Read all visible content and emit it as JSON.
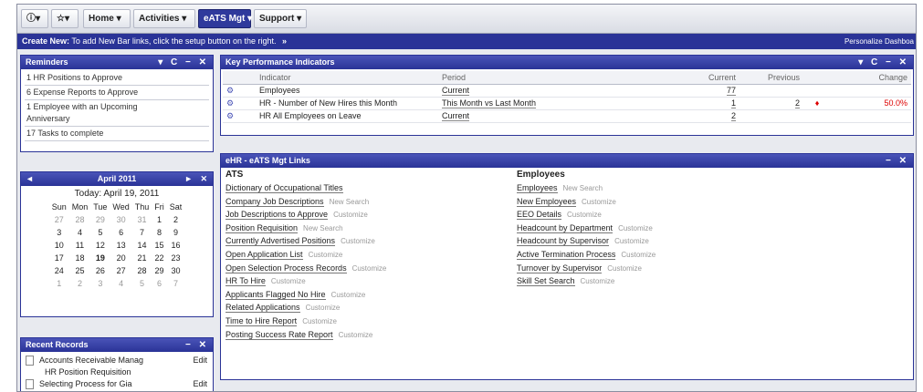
{
  "nav": {
    "home": "Home",
    "activities": "Activities",
    "eats": "eATS Mgt",
    "support": "Support",
    "dd": "▾"
  },
  "create": {
    "label": "Create New:",
    "text": "To add New Bar links, click the setup button on the right.",
    "arrow": "»",
    "personalize": "Personalize Dashboa"
  },
  "reminders": {
    "title": "Reminders",
    "controls": "▾ C − ✕",
    "items": [
      "1 HR Positions to Approve",
      "6 Expense Reports to Approve",
      "1 Employee with an Upcoming Anniversary",
      "17 Tasks to complete"
    ]
  },
  "calendar": {
    "title": "April 2011",
    "today": "Today: April 19, 2011",
    "days": [
      "Sun",
      "Mon",
      "Tue",
      "Wed",
      "Thu",
      "Fri",
      "Sat"
    ],
    "weeks": [
      [
        "27",
        "28",
        "29",
        "30",
        "31",
        "1",
        "2"
      ],
      [
        "3",
        "4",
        "5",
        "6",
        "7",
        "8",
        "9"
      ],
      [
        "10",
        "11",
        "12",
        "13",
        "14",
        "15",
        "16"
      ],
      [
        "17",
        "18",
        "19",
        "20",
        "21",
        "22",
        "23"
      ],
      [
        "24",
        "25",
        "26",
        "27",
        "28",
        "29",
        "30"
      ],
      [
        "1",
        "2",
        "3",
        "4",
        "5",
        "6",
        "7"
      ]
    ],
    "prev": "◄",
    "next": "►",
    "close": "✕"
  },
  "recent": {
    "title": "Recent Records",
    "controls": "− ✕",
    "rows": [
      {
        "name": "Accounts Receivable Manag",
        "edit": "Edit",
        "sub": "HR Position Requisition"
      },
      {
        "name": "Selecting Process for Gia",
        "edit": "Edit"
      }
    ]
  },
  "kpi": {
    "title": "Key Performance Indicators",
    "controls": "▾ C − ✕",
    "headers": [
      "Indicator",
      "Period",
      "Current",
      "Previous",
      "Change"
    ],
    "rows": [
      {
        "indicator": "Employees",
        "period": "Current",
        "current": "77",
        "previous": "",
        "change": ""
      },
      {
        "indicator": "HR - Number of New Hires this Month",
        "period": "This Month vs Last Month",
        "current": "1",
        "previous": "2",
        "change": "50.0%",
        "arrow": "♦"
      },
      {
        "indicator": "HR All Employees on Leave",
        "period": "Current",
        "current": "2",
        "previous": "",
        "change": ""
      }
    ]
  },
  "links": {
    "title": "eHR - eATS Mgt Links",
    "controls": "− ✕",
    "ats": {
      "heading": "ATS",
      "items": [
        {
          "label": "Dictionary of Occupational Titles",
          "extra": ""
        },
        {
          "label": "Company Job Descriptions",
          "extra": "New  Search"
        },
        {
          "label": "Job Descriptions to Approve",
          "extra": "Customize"
        },
        {
          "label": "Position Requisition",
          "extra": "New  Search"
        },
        {
          "label": "Currently Advertised Positions",
          "extra": "Customize"
        },
        {
          "label": "Open Application List",
          "extra": "Customize"
        },
        {
          "label": "Open Selection Process Records",
          "extra": "Customize"
        },
        {
          "label": "HR To Hire",
          "extra": "Customize"
        },
        {
          "label": "Applicants Flagged No Hire",
          "extra": "Customize"
        },
        {
          "label": "Related Applications",
          "extra": "Customize"
        },
        {
          "label": "Time to Hire Report",
          "extra": "Customize"
        },
        {
          "label": "Posting Success Rate Report",
          "extra": "Customize"
        }
      ]
    },
    "emp": {
      "heading": "Employees",
      "items": [
        {
          "label": "Employees",
          "extra": "New  Search"
        },
        {
          "label": "New Employees",
          "extra": "Customize"
        },
        {
          "label": "EEO Details",
          "extra": "Customize"
        },
        {
          "label": "Headcount by Department",
          "extra": "Customize"
        },
        {
          "label": "Headcount by Supervisor",
          "extra": "Customize"
        },
        {
          "label": "Active Termination Process",
          "extra": "Customize"
        },
        {
          "label": "Turnover by Supervisor",
          "extra": "Customize"
        },
        {
          "label": "Skill Set Search",
          "extra": "Customize"
        }
      ]
    }
  }
}
